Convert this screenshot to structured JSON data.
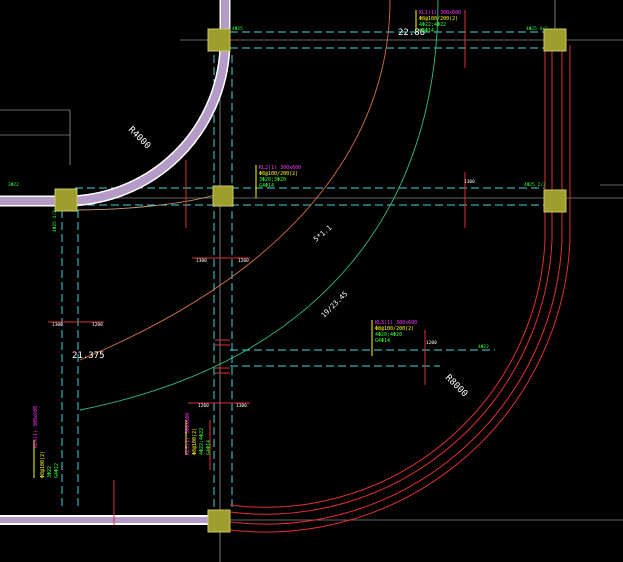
{
  "drawing": {
    "background": "#000000",
    "colors": {
      "beam_outline": "#ffffff",
      "beam_fill": "#b49bc8",
      "dashed_axis": "#44d4dc",
      "column_fill": "#9e9e2e",
      "column_stroke": "#c8c860",
      "red_line": "#e03030",
      "contour_green": "#30c080",
      "contour_orange": "#d07040",
      "contour_tan": "#c8a070",
      "label_yellow": "#ffff00",
      "label_magenta": "#ff30ff",
      "label_green": "#30ff30",
      "text_white": "#ffffff"
    },
    "labels": {
      "radius_small": "R4000",
      "radius_large": "R8000",
      "elev_top": "22.86",
      "elev_left": "21.375",
      "contour_mid": "5*1.1",
      "contour_low": "19/23.45"
    },
    "annotations": {
      "tag_top": [
        "KL1(1) 300x600",
        "Φ8@100/200(2)",
        "4Φ22;4Φ22",
        "G4Φ14"
      ],
      "tag_mid": [
        "KL2(1) 300x600",
        "Φ8@100/200(2)",
        "3Φ20;3Φ20",
        "G4Φ14"
      ],
      "tag_right": [
        "KL3(1) 300x600",
        "Φ8@100/200(2)",
        "4Φ20;4Φ20",
        "G4Φ14"
      ],
      "tag_left": [
        "KL4(1) 300x600",
        "Φ8@100(2)",
        "3Φ22",
        "G4Φ12"
      ],
      "tag_bottom": [
        "KL5(1) 300x600",
        "Φ8@100(2)",
        "4Φ22;4Φ22",
        "G4Φ14"
      ]
    },
    "small_text": [
      "1300",
      "1200",
      "1300",
      "1200",
      "1200",
      "1300",
      "1300",
      "1200",
      "4Φ25 4/2",
      "4Φ25",
      "4Φ25 2/2",
      "4Φ22",
      "3Φ22",
      "4Φ25 4/2"
    ]
  }
}
